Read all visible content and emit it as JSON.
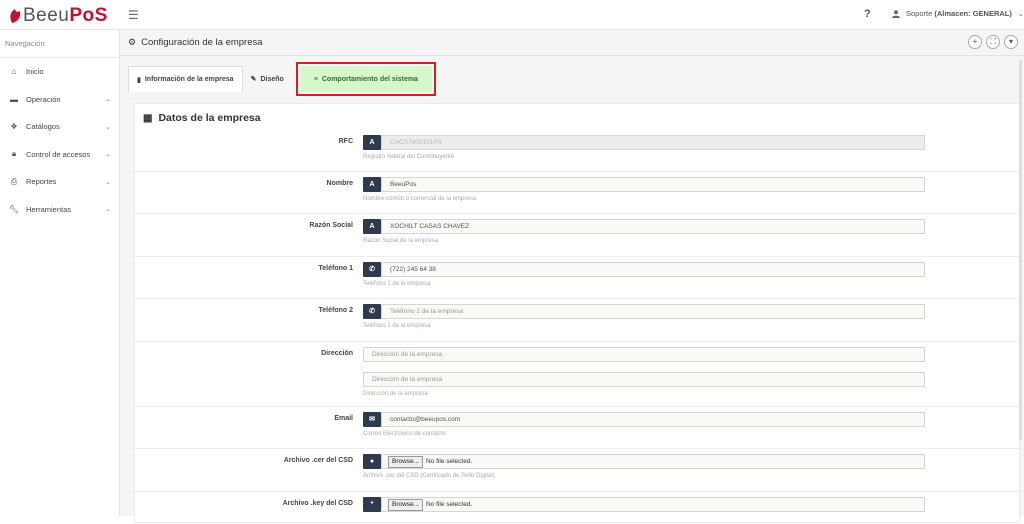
{
  "brand": {
    "part1": "Beeu",
    "part2": "PoS"
  },
  "topbar": {
    "menu_icon": "menu-toggle-icon",
    "help": "?",
    "user_name": "Soporte",
    "user_store": "(Almacen: GENERAL)"
  },
  "sidebar": {
    "heading": "Navegación",
    "items": [
      {
        "label": "Inicio",
        "icon": "home-icon",
        "chevron": false
      },
      {
        "label": "Operación",
        "icon": "briefcase-icon",
        "chevron": true
      },
      {
        "label": "Catálogos",
        "icon": "cubes-icon",
        "chevron": true
      },
      {
        "label": "Control de accesos",
        "icon": "lock-icon",
        "chevron": true
      },
      {
        "label": "Reportes",
        "icon": "print-icon",
        "chevron": true
      },
      {
        "label": "Herramientas",
        "icon": "wrench-icon",
        "chevron": true
      }
    ]
  },
  "page": {
    "title": "Configuración de la empresa",
    "buttons": [
      "+",
      "⛶",
      "▾"
    ]
  },
  "tabs": [
    {
      "label": "Información de la empresa",
      "icon": "book-icon"
    },
    {
      "label": "Diseño",
      "icon": "pencil-icon"
    },
    {
      "label": "Comportamiento del sistema",
      "icon": "list-icon"
    }
  ],
  "panel": {
    "title": "Datos de la empresa"
  },
  "form": {
    "rfc": {
      "label": "RFC",
      "addon": "A",
      "value": "CACX7605101P8",
      "help": "Registro federal del Contribuyente"
    },
    "nombre": {
      "label": "Nombre",
      "addon": "A",
      "value": "BeeuPos",
      "help": "Nombre común o comercial de la empresa"
    },
    "razon": {
      "label": "Razón Social",
      "addon": "A",
      "value": "XOCHILT CASAS CHAVEZ",
      "help": "Razón Social de la empresa"
    },
    "tel1": {
      "label": "Teléfono 1",
      "value": "(722) 245 64 38",
      "help": "Teléfono 1 de la empresa"
    },
    "tel2": {
      "label": "Teléfono 2",
      "placeholder": "Teléfono 2 de la empresa",
      "help": "Teléfono 1 de la empresa"
    },
    "direccion": {
      "label": "Dirección",
      "placeholder1": "Dirección de la empresa",
      "placeholder2": "Dirección de la empresa",
      "help": "Dirección de la empresa"
    },
    "email": {
      "label": "Email",
      "value": "contacto@beeupos.com",
      "help": "Correo Electrónico de contacto"
    },
    "cer": {
      "label": "Archivo .cer del CSD",
      "button": "Browse...",
      "status": "No file selected.",
      "help": "Archivo .cer del CSD (Certificado de Sello Digital)"
    },
    "key": {
      "label": "Archivo .key del CSD",
      "addon": "*",
      "button": "Browse...",
      "status": "No file selected."
    }
  }
}
